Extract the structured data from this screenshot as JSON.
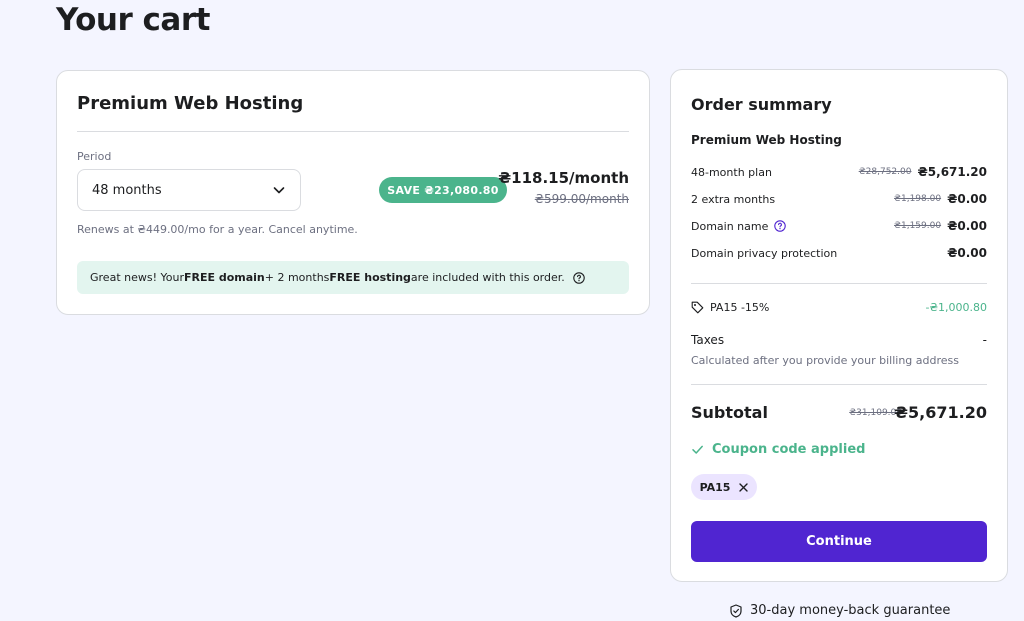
{
  "page": {
    "title": "Your cart"
  },
  "cart": {
    "product_title": "Premium Web Hosting",
    "period_label": "Period",
    "period_value": "48 months",
    "save_badge": "SAVE ₴23,080.80",
    "price_now": "₴118.15/month",
    "price_old": "₴599.00/month",
    "renew_note": "Renews at ₴449.00/mo for a year. Cancel anytime.",
    "promo": {
      "text1": "Great news! Your ",
      "bold1": "FREE domain",
      "text2": " + 2 months ",
      "bold2": "FREE hosting",
      "text3": " are included with this order."
    }
  },
  "summary": {
    "title": "Order summary",
    "product": "Premium Web Hosting",
    "lines": [
      {
        "label": "48-month plan",
        "old": "₴28,752.00",
        "value": "₴5,671.20"
      },
      {
        "label": "2 extra months",
        "old": "₴1,198.00",
        "value": "₴0.00"
      },
      {
        "label": "Domain name",
        "old": "₴1,159.00",
        "value": "₴0.00"
      },
      {
        "label": "Domain privacy protection",
        "old": "",
        "value": "₴0.00"
      }
    ],
    "coupon_line": {
      "label": "PA15 -15%",
      "value": "-₴1,000.80"
    },
    "taxes_label": "Taxes",
    "taxes_value": "-",
    "taxes_note": "Calculated after you provide your billing address",
    "subtotal_label": "Subtotal",
    "subtotal_old": "₴31,109.00",
    "subtotal_value": "₴5,671.20",
    "coupon_applied": "Coupon code applied",
    "coupon_code": "PA15",
    "continue_label": "Continue"
  },
  "footer": {
    "guarantee": "30-day money-back guarantee"
  },
  "colors": {
    "brand": "#5025d1",
    "success": "#4bb48c",
    "background": "#f4f5ff"
  }
}
